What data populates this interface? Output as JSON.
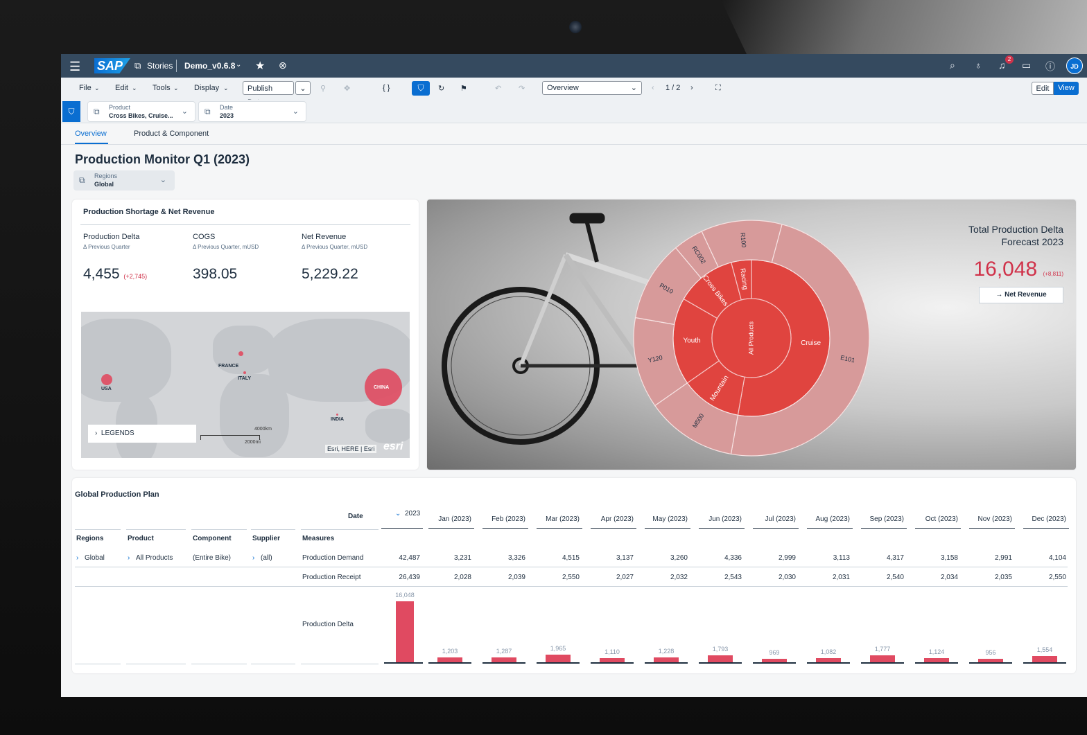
{
  "shell": {
    "logo": "SAP",
    "section": "Stories",
    "document": "Demo_v0.6.8",
    "notifications": "2",
    "avatar": "JD"
  },
  "toolbar": {
    "menus": [
      "File",
      "Edit",
      "Tools",
      "Display"
    ],
    "publish": "Publish Data",
    "curly": "{ }",
    "page_select": "Overview",
    "page_indicator": "1 / 2",
    "edit": "Edit",
    "view": "View"
  },
  "filters": {
    "product_label": "Product",
    "product_value": "Cross Bikes, Cruise...",
    "date_label": "Date",
    "date_value": "2023"
  },
  "tabs": [
    "Overview",
    "Product & Component"
  ],
  "page_title": "Production Monitor Q1 (2023)",
  "regions_filter": {
    "label": "Regions",
    "value": "Global"
  },
  "kpi_card": {
    "title": "Production Shortage & Net Revenue",
    "kpis": [
      {
        "name": "Production Delta",
        "sub": "Δ Previous Quarter",
        "value": "4,455",
        "delta": "(+2,745)"
      },
      {
        "name": "COGS",
        "sub": "Δ Previous Quarter, mUSD",
        "value": "398.05",
        "delta": ""
      },
      {
        "name": "Net Revenue",
        "sub": "Δ Previous Quarter, mUSD",
        "value": "5,229.22",
        "delta": ""
      }
    ],
    "map": {
      "labels": {
        "usa": "USA",
        "france": "FRANCE",
        "italy": "ITALY",
        "china": "CHINA",
        "india": "INDIA"
      },
      "legends": "LEGENDS",
      "scale_km": "4000km",
      "scale_mi": "2000mi",
      "attribution": "Esri, HERE | Esri",
      "esri_logo": "esri"
    }
  },
  "forecast": {
    "title_line1": "Total Production Delta",
    "title_line2": "Forecast 2023",
    "value": "16,048",
    "delta": "(+8,811)",
    "button": "→ Net Revenue",
    "sunburst": {
      "center": "All Products",
      "ring1": [
        "Cruise",
        "Mountain",
        "Youth",
        "Cross Bikes",
        "Racing"
      ],
      "ring2": [
        "E101",
        "M500",
        "Y120",
        "P010",
        "RC002",
        "R100"
      ]
    }
  },
  "plan": {
    "title": "Global Production Plan",
    "date_label": "Date",
    "year": "2023",
    "months": [
      "Jan (2023)",
      "Feb (2023)",
      "Mar (2023)",
      "Apr (2023)",
      "May (2023)",
      "Jun (2023)",
      "Jul (2023)",
      "Aug (2023)",
      "Sep (2023)",
      "Oct (2023)",
      "Nov (2023)",
      "Dec (2023)"
    ],
    "dim_headers": [
      "Regions",
      "Product",
      "Component",
      "Supplier",
      "Measures"
    ],
    "dims": {
      "region": "Global",
      "product": "All Products",
      "component": "(Entire Bike)",
      "supplier": "(all)"
    },
    "rows": [
      {
        "measure": "Production Demand",
        "total": "42,487",
        "values": [
          "3,231",
          "3,326",
          "4,515",
          "3,137",
          "3,260",
          "4,336",
          "2,999",
          "3,113",
          "4,317",
          "3,158",
          "2,991",
          "4,104"
        ]
      },
      {
        "measure": "Production Receipt",
        "total": "26,439",
        "values": [
          "2,028",
          "2,039",
          "2,550",
          "2,027",
          "2,032",
          "2,543",
          "2,030",
          "2,031",
          "2,540",
          "2,034",
          "2,035",
          "2,550"
        ]
      }
    ],
    "delta_measure": "Production Delta",
    "delta_total_label": "16,048",
    "delta_labels": [
      "1,203",
      "1,287",
      "1,965",
      "1,110",
      "1,228",
      "1,793",
      "969",
      "1,082",
      "1,777",
      "1,124",
      "956",
      "1,554"
    ],
    "accent": "#e04a61"
  },
  "chart_data": {
    "type": "bar",
    "categories": [
      "2023",
      "Jan (2023)",
      "Feb (2023)",
      "Mar (2023)",
      "Apr (2023)",
      "May (2023)",
      "Jun (2023)",
      "Jul (2023)",
      "Aug (2023)",
      "Sep (2023)",
      "Oct (2023)",
      "Nov (2023)",
      "Dec (2023)"
    ],
    "values": [
      16048,
      1203,
      1287,
      1965,
      1110,
      1228,
      1793,
      969,
      1082,
      1777,
      1124,
      956,
      1554
    ]
  }
}
